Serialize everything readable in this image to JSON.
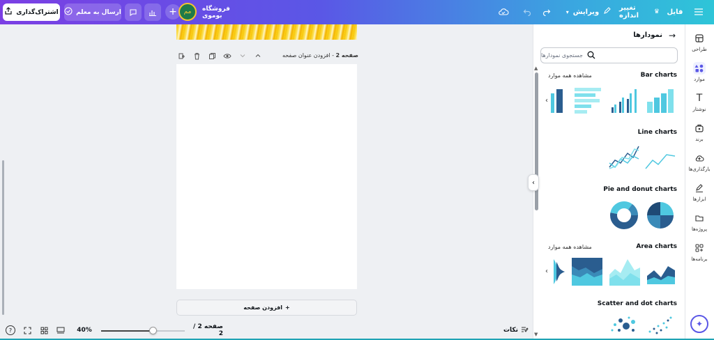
{
  "topbar": {
    "share_label": "اشتراک‌گذاری",
    "send_label": "ارسال به معلم",
    "store_name": "فروشگاه بوموی",
    "edit_label": "ویرایش",
    "resize_label": "تغییر اندازه",
    "file_label": "فایل",
    "avatar_text": "مم"
  },
  "canvas": {
    "page_label_bold": "صفحه 2",
    "page_label_rest": " - افزودن عنوان صفحه",
    "add_page_label": "افزودن صفحه"
  },
  "bottombar": {
    "zoom": "40%",
    "zoom_fraction": 0.4,
    "page_count": "صفحه 2 / 2",
    "notes_label": "نکات",
    "help_label": "?"
  },
  "panel": {
    "title": "نمودارها",
    "search_placeholder": "جستجوی نمودارها",
    "see_all": "مشاهده همه موارد",
    "sections": [
      {
        "title": "Bar charts"
      },
      {
        "title": "Line charts"
      },
      {
        "title": "Pie and donut charts"
      },
      {
        "title": "Area charts"
      },
      {
        "title": "Scatter and dot charts"
      }
    ]
  },
  "rail": {
    "items": [
      {
        "label": "طراحی",
        "icon": "layout-icon"
      },
      {
        "label": "موارد",
        "icon": "elements-icon"
      },
      {
        "label": "نوشتار",
        "icon": "text-icon"
      },
      {
        "label": "برند",
        "icon": "brand-icon"
      },
      {
        "label": "بارگذاری‌ها",
        "icon": "upload-icon"
      },
      {
        "label": "ابزارها",
        "icon": "draw-icon"
      },
      {
        "label": "پروژه‌ها",
        "icon": "folder-icon"
      },
      {
        "label": "برنامه‌ها",
        "icon": "apps-icon"
      }
    ]
  },
  "colors": {
    "accent": "#5a57e6",
    "chart_dark": "#2a5d8f",
    "chart_light": "#4fc8e0"
  }
}
